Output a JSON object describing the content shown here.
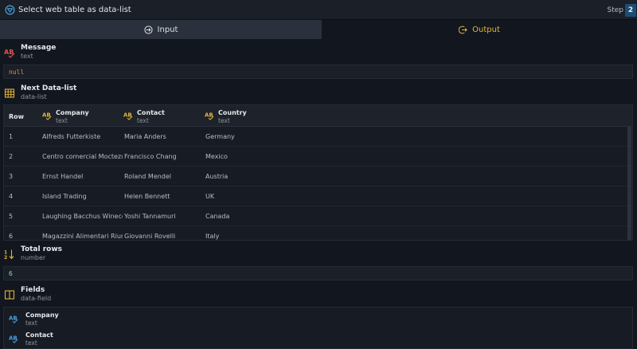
{
  "window": {
    "title": "Select web table as data-list",
    "step_label": "Step",
    "step_number": "2"
  },
  "tabs": [
    {
      "label": "Input",
      "active": false
    },
    {
      "label": "Output",
      "active": true
    }
  ],
  "message": {
    "name": "Message",
    "type": "text",
    "value": "null",
    "icon": "text-type-icon"
  },
  "next_datalist": {
    "name": "Next Data-list",
    "type": "data-list",
    "icon": "grid-table-icon",
    "columns": [
      {
        "name": "Row"
      },
      {
        "name": "Company",
        "type": "text"
      },
      {
        "name": "Contact",
        "type": "text"
      },
      {
        "name": "Country",
        "type": "text"
      }
    ],
    "rows": [
      [
        "1",
        "Alfreds Futterkiste",
        "Maria Anders",
        "Germany"
      ],
      [
        "2",
        "Centro comercial Moctezuma",
        "Francisco Chang",
        "Mexico"
      ],
      [
        "3",
        "Ernst Handel",
        "Roland Mendel",
        "Austria"
      ],
      [
        "4",
        "Island Trading",
        "Helen Bennett",
        "UK"
      ],
      [
        "5",
        "Laughing Bacchus Winecellars",
        "Yoshi Tannamuri",
        "Canada"
      ],
      [
        "6",
        "Magazzini Alimentari Riuniti",
        "Giovanni Rovelli",
        "Italy"
      ]
    ]
  },
  "total_rows": {
    "name": "Total rows",
    "type": "number",
    "value": "6",
    "icon": "sort-numbers-icon"
  },
  "fields": {
    "name": "Fields",
    "type": "data-field",
    "icon": "columns-icon",
    "items": [
      {
        "name": "Company",
        "type": "text"
      },
      {
        "name": "Contact",
        "type": "text"
      }
    ]
  },
  "colors": {
    "accent_orange": "#e2b43a",
    "text_red": "#e0524a",
    "info_blue": "#4aa3df",
    "step_badge": "#1d4d72"
  }
}
